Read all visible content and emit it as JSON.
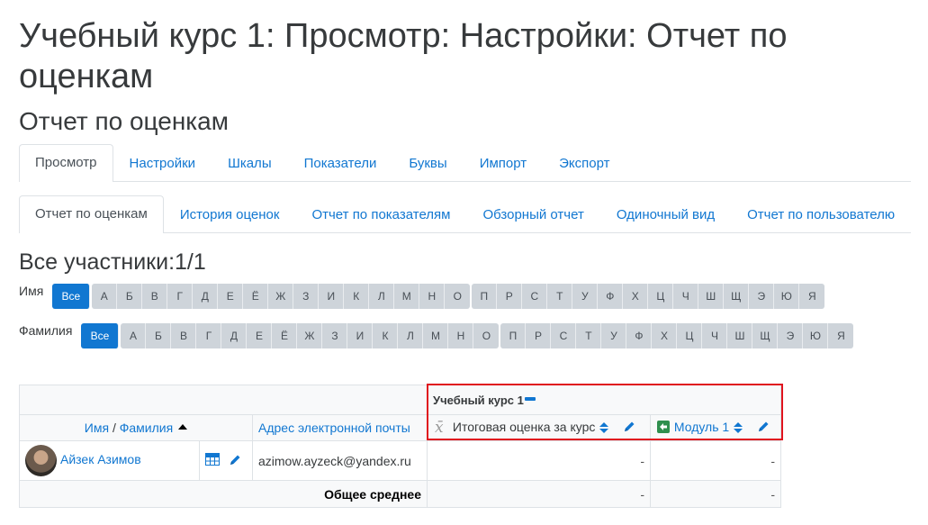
{
  "page": {
    "title": "Учебный курс 1: Просмотр: Настройки: Отчет по оценкам",
    "subtitle": "Отчет по оценкам"
  },
  "tabs_primary": [
    {
      "label": "Просмотр",
      "active": true
    },
    {
      "label": "Настройки",
      "active": false
    },
    {
      "label": "Шкалы",
      "active": false
    },
    {
      "label": "Показатели",
      "active": false
    },
    {
      "label": "Буквы",
      "active": false
    },
    {
      "label": "Импорт",
      "active": false
    },
    {
      "label": "Экспорт",
      "active": false
    }
  ],
  "tabs_secondary": [
    {
      "label": "Отчет по оценкам",
      "active": true
    },
    {
      "label": "История оценок",
      "active": false
    },
    {
      "label": "Отчет по показателям",
      "active": false
    },
    {
      "label": "Обзорный отчет",
      "active": false
    },
    {
      "label": "Одиночный вид",
      "active": false
    },
    {
      "label": "Отчет по пользователю",
      "active": false
    }
  ],
  "participants": {
    "heading": "Все участники:1/1",
    "first_name_label": "Имя",
    "last_name_label": "Фамилия",
    "all_label": "Все",
    "letters": [
      "А",
      "Б",
      "В",
      "Г",
      "Д",
      "Е",
      "Ё",
      "Ж",
      "З",
      "И",
      "К",
      "Л",
      "М",
      "Н",
      "О",
      "П",
      "Р",
      "С",
      "Т",
      "У",
      "Ф",
      "Х",
      "Ц",
      "Ч",
      "Ш",
      "Щ",
      "Э",
      "Ю",
      "Я"
    ]
  },
  "table": {
    "category_name": "Учебный курс 1",
    "col_name_first": "Имя",
    "col_name_sep": " / ",
    "col_name_last": "Фамилия",
    "col_email": "Адрес электронной почты",
    "col_course_total": "Итоговая оценка за курс",
    "col_module": "Модуль 1",
    "student": {
      "name": "Айзек Азимов",
      "email": "azimow.ayzeck@yandex.ru",
      "course_total": "-",
      "module": "-"
    },
    "average_label": "Общее среднее",
    "average_course_total": "-",
    "average_module": "-"
  },
  "colors": {
    "accent": "#1177d1",
    "highlight_border": "#e0141e",
    "letter_bg": "#ced4da"
  }
}
